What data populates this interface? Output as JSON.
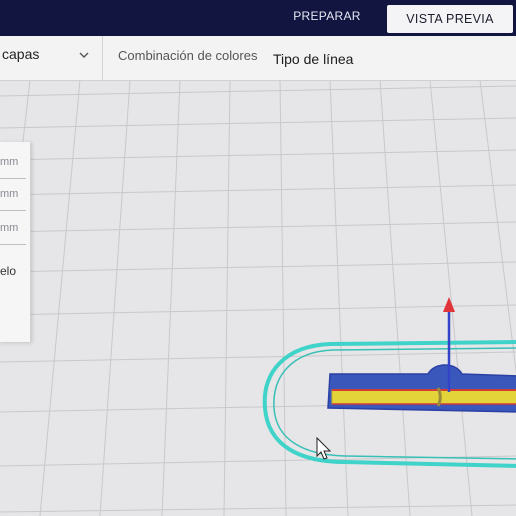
{
  "header": {
    "tab_prepare": "PREPARAR",
    "tab_preview": "VISTA PREVIA"
  },
  "toolbar": {
    "view_type_value": "capas",
    "color_scheme_label": "Combinación de colores",
    "color_scheme_value": "Tipo de línea"
  },
  "side_panel": {
    "field_1_unit": "mm",
    "field_2_unit": "mm",
    "field_3_unit": "mm",
    "label_partial": "elo"
  },
  "colors": {
    "header_bg": "#11153f",
    "build_plate": "#e6e5e7",
    "grid_line": "#cacaCE",
    "skirt_cyan": "#3fd3c9",
    "wall_blue": "#3b5fc7",
    "infill_yellow": "#e7d83a",
    "gizmo_red": "#e0343a",
    "gizmo_blue": "#3344c8"
  },
  "icons": {
    "dropdown": "chevron-down-icon",
    "cursor": "mouse-pointer-icon",
    "gizmo": "move-gizmo-icon"
  }
}
